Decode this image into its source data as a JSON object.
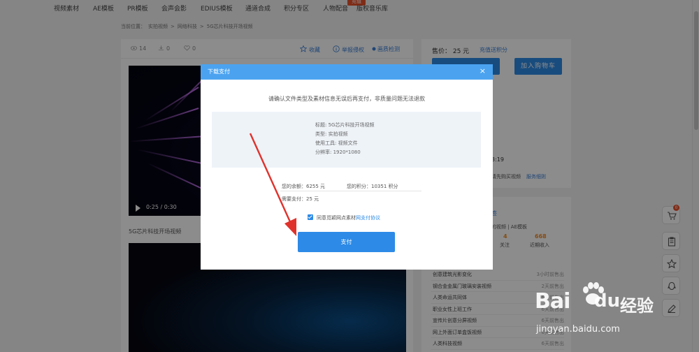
{
  "nav": {
    "items": [
      "视频素材",
      "AE模板",
      "PR模板",
      "会声会影",
      "EDIUS模板",
      "通道合成",
      "积分专区",
      "人物配音",
      "版权音乐库"
    ],
    "hot_badge": "充值"
  },
  "breadcrumb": [
    "当前位置：",
    "实拍视频",
    ">",
    "网络科技",
    ">",
    "5G芯片科技开场视频"
  ],
  "stats": {
    "views": "14",
    "downloads": "0",
    "likes": "0"
  },
  "tools": {
    "collect": "收藏",
    "report": "举报侵权",
    "check": "画质检测"
  },
  "video": {
    "time": "0:25 / 0:30",
    "title": "5G芯片科技开场视频"
  },
  "side": {
    "price": "售价： 25 元",
    "price_link": "充值送积分",
    "cart_button": "加入购物车",
    "time_fragment": "3:19",
    "note": "请先购买视频",
    "note_link": "服务细则",
    "author_link": "签",
    "author_sub": "的视频 | AE模板",
    "follow_num": "4",
    "follow_label": "关注",
    "income_num": "668",
    "income_label": "近期收入",
    "rank": [
      {
        "title": "创意建筑光影变化",
        "time": "3小时前售出"
      },
      {
        "title": "钢合金金属门玻璃安装视频",
        "time": "2天前售出"
      },
      {
        "title": "人类命运共同体",
        "time": "6天前售出"
      },
      {
        "title": "职业女性上班工作",
        "time": "6天前售出"
      },
      {
        "title": "宣传片创意分屏视频",
        "time": "6天前售出"
      },
      {
        "title": "网上外面订单盒饭视频",
        "time": "6天前售出"
      },
      {
        "title": "人类科技视频",
        "time": "6天前售出"
      }
    ]
  },
  "float_bar": {
    "cart_count": "0"
  },
  "modal": {
    "title": "下载支付",
    "close": "×",
    "notice": "请确认文件类型及素材信息无误后再支付，非质量问题无法退款",
    "info": [
      "标题: 5G芯片科技开场视频",
      "类型: 实拍视频",
      "使用工具: 视频文件",
      "分辨率: 1920*1080"
    ],
    "balance": "您的余额：6255 元",
    "points": "您的积分：10351 积分",
    "need_pay": "需要支付：25 元",
    "agree_text": "同意觅颖网点素材",
    "agree_link": "网支付协议",
    "pay_button": "支付"
  },
  "watermark": {
    "brand": "Bai",
    "brand2": "du",
    "suffix": "经验",
    "url": "jingyan.baidu.com"
  },
  "colors": {
    "accent": "#2d8ae6",
    "modal_header": "#4ba3f0",
    "arrow": "#e0322c",
    "orange": "#f08a24"
  }
}
